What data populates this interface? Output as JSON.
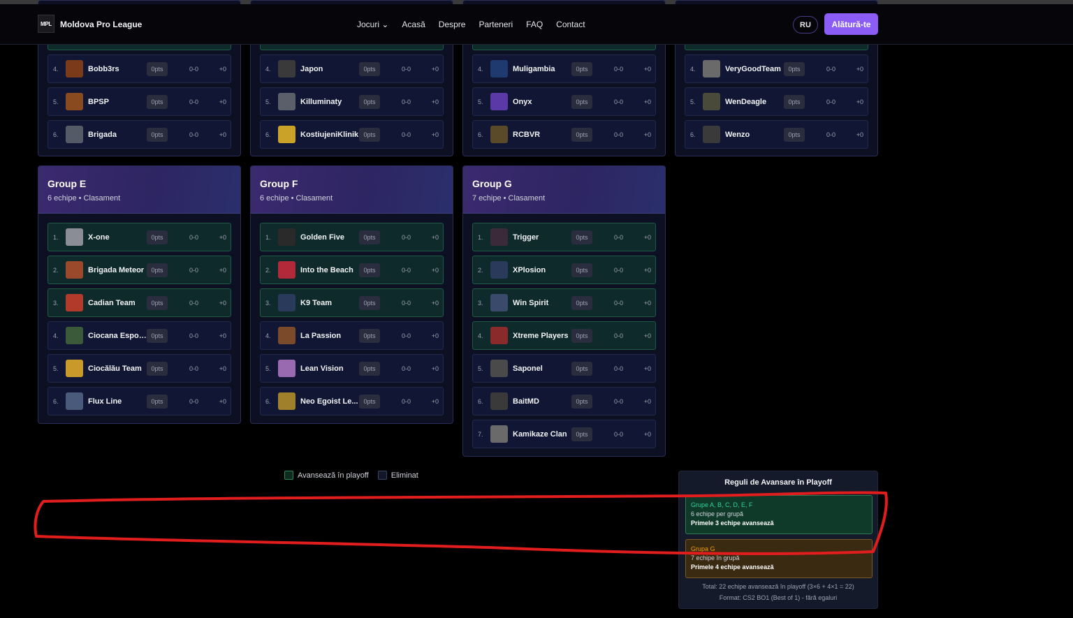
{
  "nav": {
    "logo": "MPL",
    "brand": "Moldova Pro League",
    "links": [
      "Jocuri ⌄",
      "Acasă",
      "Despre",
      "Parteneri",
      "FAQ",
      "Contact"
    ],
    "lang": "RU",
    "join": "Alătură-te"
  },
  "pts_label": "0pts",
  "record": "0-0",
  "diff": "+0",
  "top_groups": [
    {
      "teams": [
        {
          "rank": "4.",
          "name": "Bobb3rs",
          "color": "#7a3b1a",
          "adv": false
        },
        {
          "rank": "5.",
          "name": "BPSP",
          "color": "#8a4a20",
          "adv": false
        },
        {
          "rank": "6.",
          "name": "Brigada",
          "color": "#555b66",
          "adv": false
        }
      ]
    },
    {
      "teams": [
        {
          "rank": "4.",
          "name": "Japon",
          "color": "#3a3a3a",
          "adv": false
        },
        {
          "rank": "5.",
          "name": "Killuminaty",
          "color": "#5a5f6a",
          "adv": false
        },
        {
          "rank": "6.",
          "name": "KostiujeniKlinik",
          "color": "#c9a227",
          "adv": false
        }
      ]
    },
    {
      "teams": [
        {
          "rank": "4.",
          "name": "Muligambia",
          "color": "#1e3a6e",
          "adv": false
        },
        {
          "rank": "5.",
          "name": "Onyx",
          "color": "#5b3aa8",
          "adv": false
        },
        {
          "rank": "6.",
          "name": "RCBVR",
          "color": "#5a4a2a",
          "adv": false
        }
      ]
    },
    {
      "teams": [
        {
          "rank": "4.",
          "name": "VeryGoodTeam",
          "color": "#6a6a6a",
          "adv": false
        },
        {
          "rank": "5.",
          "name": "WenDeagle",
          "color": "#4a4a3a",
          "adv": false
        },
        {
          "rank": "6.",
          "name": "Wenzo",
          "color": "#3a3a3a",
          "adv": false
        }
      ]
    }
  ],
  "groups": [
    {
      "title": "Group E",
      "sub": "6 echipe • Clasament",
      "teams": [
        {
          "rank": "1.",
          "name": "X-one",
          "color": "#8a8d96",
          "adv": true
        },
        {
          "rank": "2.",
          "name": "Brigada Meteor",
          "color": "#9a4a2a",
          "adv": true
        },
        {
          "rank": "3.",
          "name": "Cadian Team",
          "color": "#b23a2a",
          "adv": true
        },
        {
          "rank": "4.",
          "name": "Ciocana Esports",
          "color": "#3a5a3a",
          "adv": false
        },
        {
          "rank": "5.",
          "name": "Ciocălău Team",
          "color": "#c99a2a",
          "adv": false
        },
        {
          "rank": "6.",
          "name": "Flux Line",
          "color": "#4a5a7a",
          "adv": false
        }
      ]
    },
    {
      "title": "Group F",
      "sub": "6 echipe • Clasament",
      "teams": [
        {
          "rank": "1.",
          "name": "Golden Five",
          "color": "#2a2a2a",
          "adv": true
        },
        {
          "rank": "2.",
          "name": "Into the Beach",
          "color": "#b22a3a",
          "adv": true
        },
        {
          "rank": "3.",
          "name": "K9 Team",
          "color": "#2a3a5a",
          "adv": true
        },
        {
          "rank": "4.",
          "name": "La Passion",
          "color": "#7a4a2a",
          "adv": false
        },
        {
          "rank": "5.",
          "name": "Lean Vision",
          "color": "#9a6ab0",
          "adv": false
        },
        {
          "rank": "6.",
          "name": "Neo Egoist Le...",
          "color": "#a0802a",
          "adv": false
        }
      ]
    },
    {
      "title": "Group G",
      "sub": "7 echipe • Clasament",
      "teams": [
        {
          "rank": "1.",
          "name": "Trigger",
          "color": "#3a2a3a",
          "adv": true
        },
        {
          "rank": "2.",
          "name": "XPlosion",
          "color": "#2a3a5a",
          "adv": true
        },
        {
          "rank": "3.",
          "name": "Win Spirit",
          "color": "#3a4a6a",
          "adv": true
        },
        {
          "rank": "4.",
          "name": "Xtreme Players",
          "color": "#8a2a2a",
          "adv": true
        },
        {
          "rank": "5.",
          "name": "Saponel",
          "color": "#4a4a4a",
          "adv": false
        },
        {
          "rank": "6.",
          "name": "BaitMD",
          "color": "#3a3a3a",
          "adv": false
        },
        {
          "rank": "7.",
          "name": "Kamikaze Clan",
          "color": "#6a6a6a",
          "adv": false
        }
      ]
    }
  ],
  "legend": {
    "advance": "Avansează în playoff",
    "eliminated": "Eliminat"
  },
  "rules": {
    "title": "Reguli de Avansare în Playoff",
    "box1": {
      "title": "Grupe A, B, C, D, E, F",
      "line": "6 echipe per grupă",
      "strong": "Primele 3 echipe avansează"
    },
    "box2": {
      "title": "Grupa G",
      "line": "7 echipe în grupă",
      "strong": "Primele 4 echipe avansează"
    },
    "total": "Total: 22 echipe avansează în playoff (3×6 + 4×1 = 22)",
    "format": "Format: CS2 BO1 (Best of 1) - fără egaluri"
  },
  "colors": {
    "accent": "#8b5cf6",
    "advance": "#2f8a55",
    "annotation": "#e11d1d"
  }
}
